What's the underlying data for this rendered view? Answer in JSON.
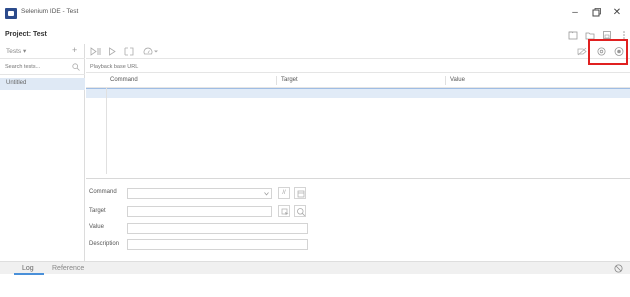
{
  "window": {
    "title": "Selenium IDE - Test"
  },
  "project": {
    "title": "Project: Test"
  },
  "tests_panel": {
    "dropdown_label": "Tests ▾",
    "add_symbol": "+",
    "search_placeholder": "Search tests...",
    "items": [
      {
        "label": "Untitled"
      }
    ]
  },
  "toolbar": {
    "base_url_placeholder": "Playback base URL"
  },
  "table": {
    "columns": [
      "Command",
      "Target",
      "Value"
    ]
  },
  "editor": {
    "command_label": "Command",
    "target_label": "Target",
    "value_label": "Value",
    "description_label": "Description",
    "command_value": "",
    "target_value": "",
    "value_value": "",
    "description_value": "",
    "comment_symbol": "//"
  },
  "bottom_tabs": {
    "log": "Log",
    "reference": "Reference"
  },
  "colors": {
    "highlight": "#e02020",
    "selection": "#e1ebf7",
    "accent": "#4a90d9"
  }
}
